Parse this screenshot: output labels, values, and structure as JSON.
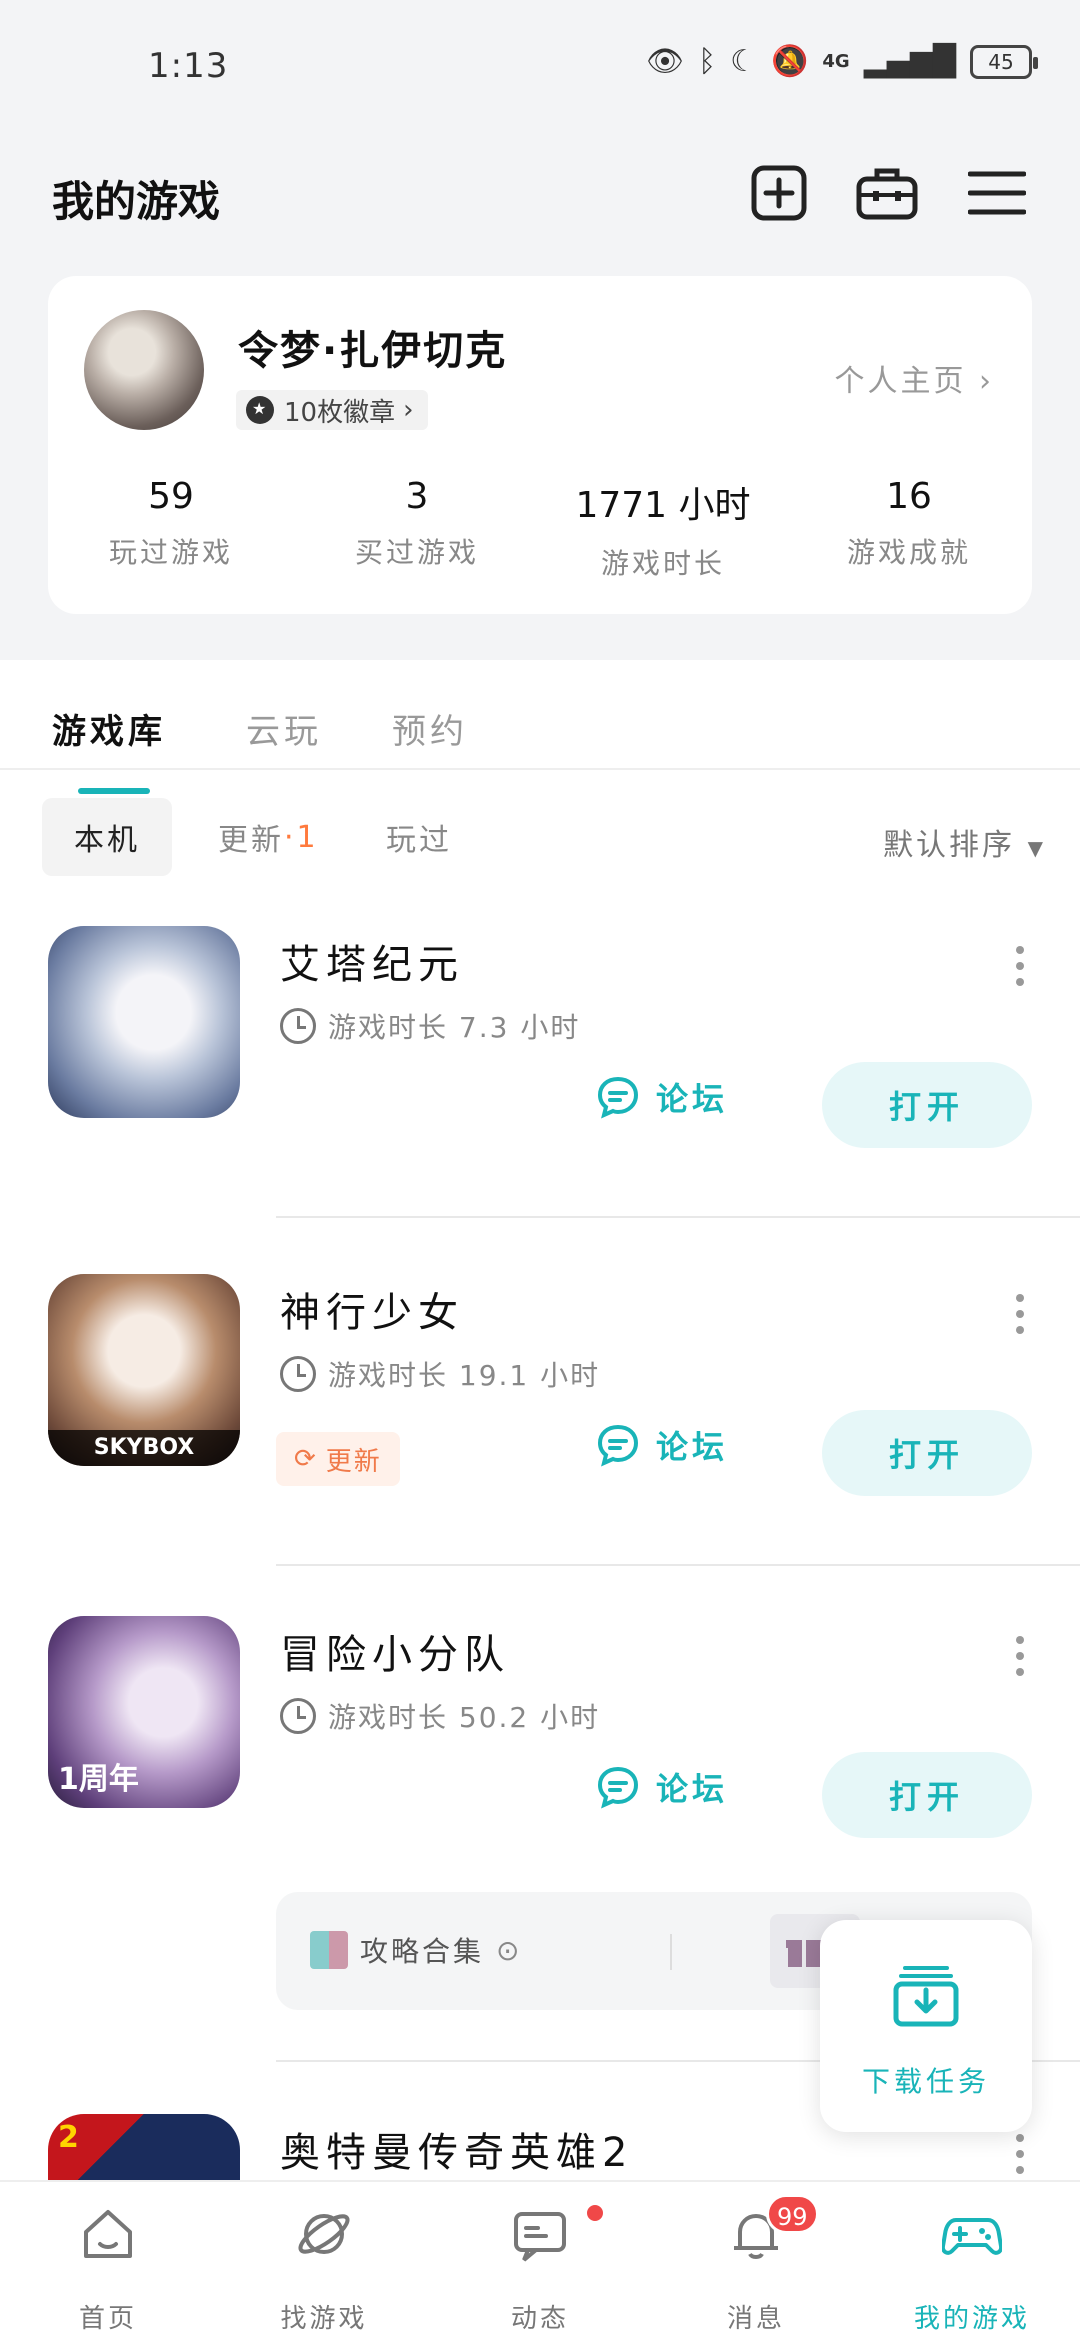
{
  "status_bar": {
    "time": "1:13",
    "network": "4G",
    "battery": "45"
  },
  "header": {
    "title": "我的游戏"
  },
  "profile": {
    "username": "令梦·扎伊切克",
    "badge_text": "10枚徽章",
    "homepage_link": "个人主页",
    "stats": [
      {
        "value": "59",
        "label": "玩过游戏"
      },
      {
        "value": "3",
        "label": "买过游戏"
      },
      {
        "value": "1771 小时",
        "label": "游戏时长"
      },
      {
        "value": "16",
        "label": "游戏成就"
      }
    ]
  },
  "tabs": [
    "游戏库",
    "云玩",
    "预约"
  ],
  "subtabs": {
    "local": "本机",
    "update": "更新",
    "update_count": "1",
    "played": "玩过",
    "sort": "默认排序"
  },
  "games": [
    {
      "name": "艾塔纪元",
      "time": "游戏时长 7.3 小时",
      "forum": "论坛",
      "open": "打开"
    },
    {
      "name": "神行少女",
      "time": "游戏时长 19.1 小时",
      "forum": "论坛",
      "open": "打开",
      "update_tag": "更新",
      "icon_label": "SKYBOX"
    },
    {
      "name": "冒险小分队",
      "time": "游戏时长 50.2 小时",
      "forum": "论坛",
      "open": "打开",
      "icon_label": "1周年"
    },
    {
      "name": "奥特曼传奇英雄2",
      "icon_label": "2"
    }
  ],
  "guide": {
    "label": "攻略合集"
  },
  "download_task": {
    "label": "下载任务"
  },
  "bottom_nav": [
    {
      "label": "首页"
    },
    {
      "label": "找游戏"
    },
    {
      "label": "动态"
    },
    {
      "label": "消息",
      "badge": "99"
    },
    {
      "label": "我的游戏"
    }
  ],
  "colors": {
    "accent": "#19b4b8",
    "update": "#f07a4a",
    "badge": "#f04848"
  }
}
